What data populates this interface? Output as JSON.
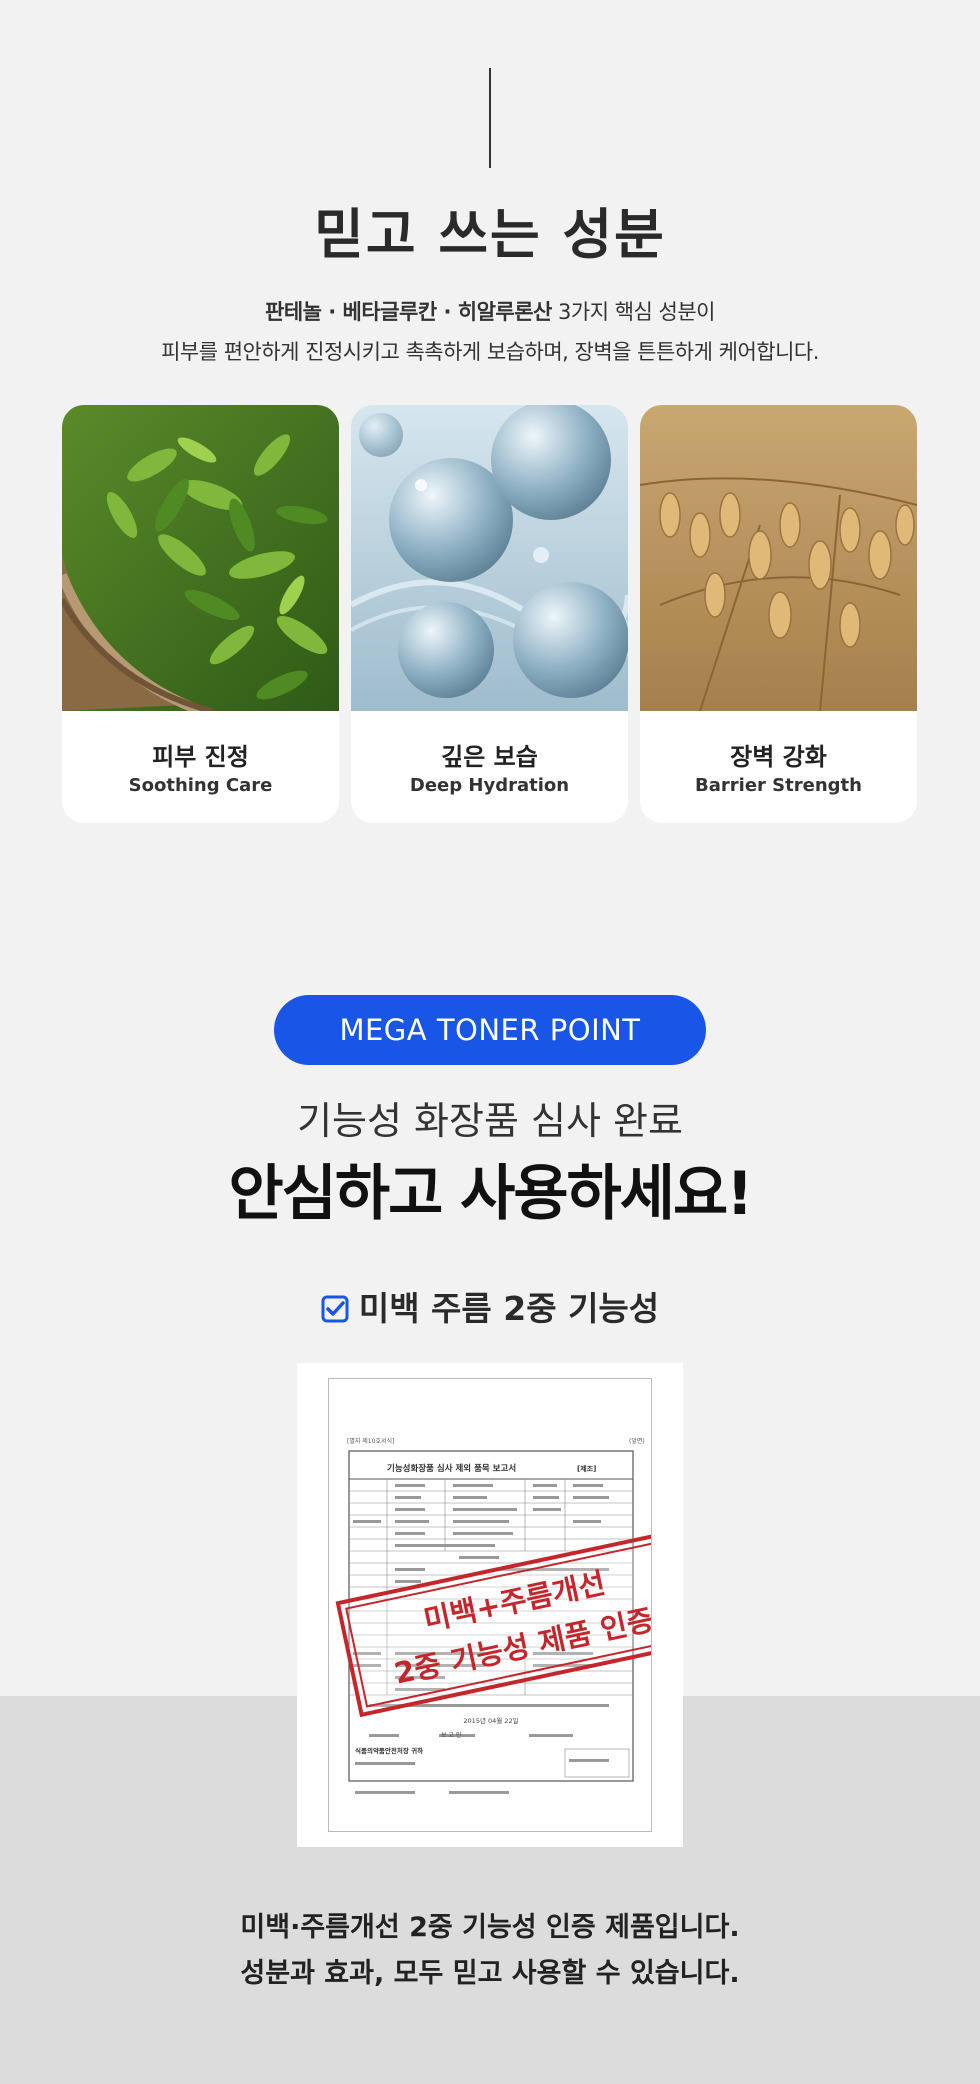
{
  "ingredients": {
    "title": "믿고 쓰는 성분",
    "intro_bold": "판테놀 · 베타글루칸 · 히알루론산",
    "intro_line1_rest": " 3가지 핵심 성분이",
    "intro_line2": "피부를 편안하게 진정시키고 촉촉하게 보습하며, 장벽을 튼튼하게 케어합니다.",
    "cards": [
      {
        "ko": "피부 진정",
        "en": "Soothing Care",
        "icon": "green-tea-leaves-image"
      },
      {
        "ko": "깊은 보습",
        "en": "Deep Hydration",
        "icon": "hydration-bubbles-image"
      },
      {
        "ko": "장벽 강화",
        "en": "Barrier Strength",
        "icon": "oat-grain-image"
      }
    ]
  },
  "point": {
    "badge": "MEGA TONER POINT",
    "sub_head": "기능성 화장품 심사 완료",
    "main_head": "안심하고 사용하세요!",
    "functional_label": "미백 주름 2중 기능성",
    "check_icon": "checkbox-checked-icon",
    "accent_color": "#1a56e6"
  },
  "document": {
    "header_left": "[별지 제10호서식]",
    "header_right": "(앞면)",
    "title": "기능성화장품 심사 제외 품목 보고서",
    "title_tag": "[제조]",
    "date_line": "2015년 04월 22일",
    "signer_line": "보 고 인",
    "agency": "식품의약품안전처장 귀하",
    "stamp_line1": "미백+주름개선",
    "stamp_line2": "2중 기능성 제품 인증",
    "stamp_color": "#c3262b"
  },
  "closing": {
    "line1": "미백·주름개선 2중 기능성 인증 제품입니다.",
    "line2": "성분과 효과, 모두 믿고 사용할 수 있습니다."
  }
}
